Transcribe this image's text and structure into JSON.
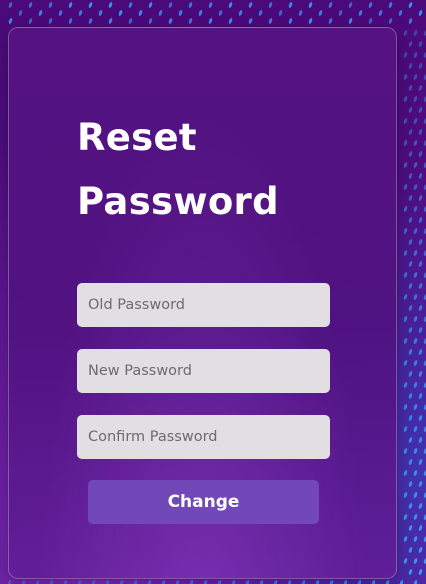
{
  "form": {
    "title_line1": "Reset",
    "title_line2": "Password",
    "old_password_placeholder": "Old Password",
    "new_password_placeholder": "New Password",
    "confirm_password_placeholder": "Confirm Password",
    "submit_label": "Change"
  },
  "colors": {
    "background": "#4a0a78",
    "card": "#551482",
    "field": "#e1dfe1",
    "button": "#7247b8",
    "dots": "#3aa0ff"
  }
}
